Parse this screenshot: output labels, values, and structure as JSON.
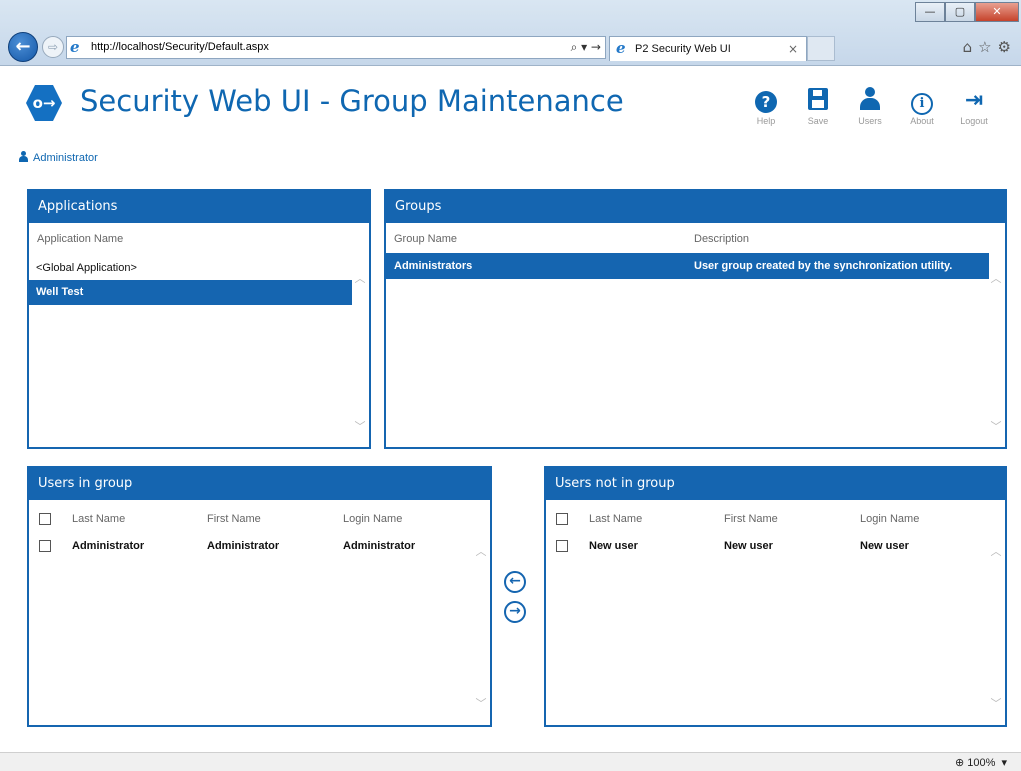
{
  "browser": {
    "address": "http://localhost/Security/Default.aspx",
    "tab_title": "P2 Security Web UI",
    "tab_close": "×",
    "zoom": "100%",
    "minimize": "—",
    "maximize": "▢",
    "close": "✕"
  },
  "app": {
    "title": "Security Web UI - Group Maintenance",
    "logo_glyph": "o→",
    "user": "Administrator"
  },
  "toolbar": {
    "help": "Help",
    "save": "Save",
    "users": "Users",
    "about": "About",
    "logout": "Logout"
  },
  "applications": {
    "header": "Applications",
    "column": "Application Name",
    "items": [
      "<Global Application>",
      "Well Test"
    ]
  },
  "groups": {
    "header": "Groups",
    "col_name": "Group Name",
    "col_desc": "Description",
    "rows": [
      {
        "name": "Administrators",
        "description": "User group created by the synchronization utility."
      }
    ]
  },
  "users_in_group": {
    "header": "Users in group",
    "col_last": "Last Name",
    "col_first": "First Name",
    "col_login": "Login Name",
    "rows": [
      {
        "last": "Administrator",
        "first": "Administrator",
        "login": "Administrator"
      }
    ]
  },
  "users_not_in_group": {
    "header": "Users not in group",
    "col_last": "Last Name",
    "col_first": "First Name",
    "col_login": "Login Name",
    "rows": [
      {
        "last": "New user",
        "first": "New user",
        "login": "New user"
      }
    ]
  },
  "colors": {
    "accent": "#1565b0",
    "title_blue": "#0f67b1"
  }
}
